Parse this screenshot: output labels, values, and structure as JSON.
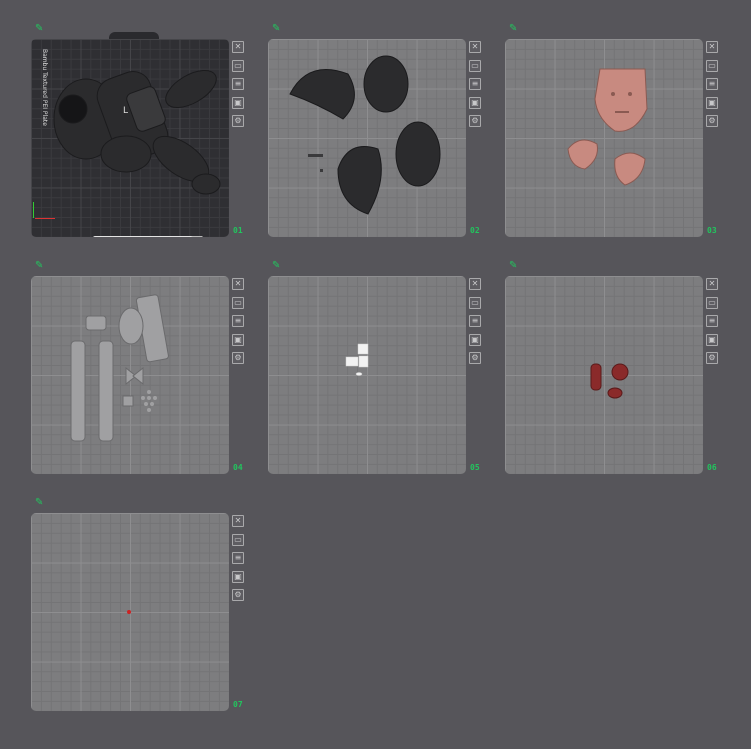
{
  "plates": [
    {
      "number": "01",
      "label": "Bambu Textured PEI Plate",
      "dark": true
    },
    {
      "number": "02",
      "dark": false
    },
    {
      "number": "03",
      "dark": false
    },
    {
      "number": "04",
      "dark": false
    },
    {
      "number": "05",
      "dark": false
    },
    {
      "number": "06",
      "dark": false
    },
    {
      "number": "07",
      "dark": false
    }
  ],
  "icons": {
    "edit": "pencil-icon",
    "tools": [
      "close-icon",
      "arrange-icon",
      "orient-icon",
      "lock-icon",
      "settings-icon"
    ]
  },
  "colors": {
    "background": "#56555a",
    "plate": "#7d7d7f",
    "plate_dark": "#2f2f33",
    "accent": "#22c55e",
    "model_dark": "#2a2a2a",
    "model_skin": "#c88a80",
    "model_grey": "#a0a0a2",
    "model_red": "#8a2a2a"
  }
}
